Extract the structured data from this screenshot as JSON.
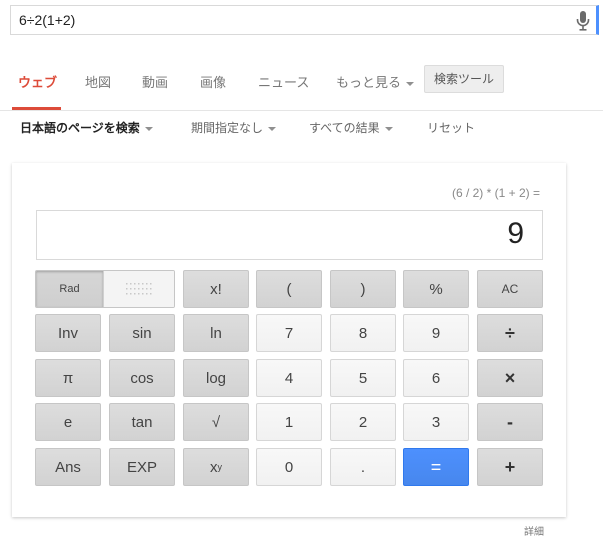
{
  "search": {
    "query": "6÷2(1+2)"
  },
  "tabs": [
    {
      "label": "ウェブ",
      "active": true
    },
    {
      "label": "地図"
    },
    {
      "label": "動画"
    },
    {
      "label": "画像"
    },
    {
      "label": "ニュース"
    },
    {
      "label": "もっと見る"
    }
  ],
  "tools_label": "検索ツール",
  "filters": [
    {
      "label": "日本語のページを検索"
    },
    {
      "label": "期間指定なし"
    },
    {
      "label": "すべての結果"
    },
    {
      "label": "リセット"
    }
  ],
  "calculator": {
    "expression": "(6 / 2) * (1 + 2) =",
    "result": "9",
    "mode_label": "Rad",
    "keys": {
      "factorial": "x!",
      "lparen": "(",
      "rparen": ")",
      "percent": "%",
      "ac": "AC",
      "inv": "Inv",
      "sin": "sin",
      "ln": "ln",
      "n7": "7",
      "n8": "8",
      "n9": "9",
      "divide": "÷",
      "pi": "π",
      "cos": "cos",
      "log": "log",
      "n4": "4",
      "n5": "5",
      "n6": "6",
      "multiply": "×",
      "e": "e",
      "tan": "tan",
      "sqrt": "√",
      "n1": "1",
      "n2": "2",
      "n3": "3",
      "minus": "-",
      "ans": "Ans",
      "exp": "EXP",
      "power_base": "x",
      "power_exp": "y",
      "n0": "0",
      "dot": ".",
      "equals": "=",
      "plus": "+"
    }
  },
  "details_label": "詳細",
  "colors": {
    "accent_tab": "#dd4b39",
    "equals_key": "#4d90fe"
  }
}
